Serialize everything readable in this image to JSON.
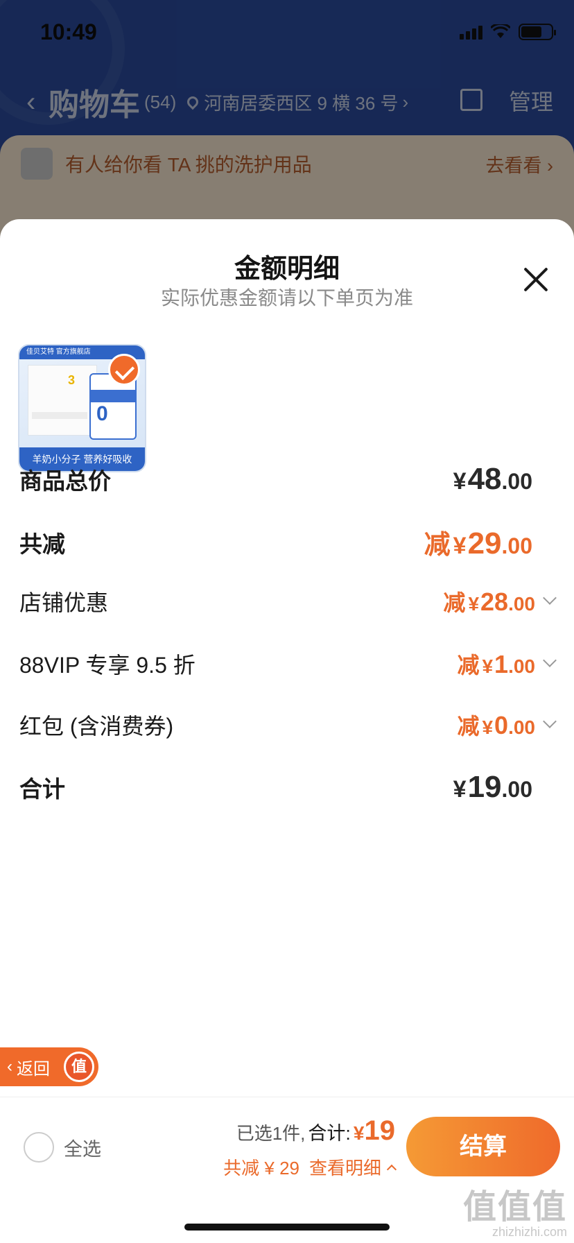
{
  "status_bar": {
    "time": "10:49"
  },
  "nav": {
    "title": "购物车",
    "count": "(54)",
    "location": "河南居委西区 9 横 36 号",
    "manage": "管理"
  },
  "banner": {
    "text": "有人给你看 TA 挑的洗护用品",
    "link": "去看看"
  },
  "sheet": {
    "title": "金额明细",
    "subtitle": "实际优惠金额请以下单页为准",
    "product": {
      "brand_bar": "佳贝艾特 官方旗舰店",
      "stage": "3",
      "panel_value": "0",
      "caption": "羊奶小分子 营养好吸收"
    },
    "rows": {
      "total": {
        "label": "商品总价",
        "cur": "¥",
        "int": "48",
        "dec": ".00"
      },
      "reduce": {
        "label": "共减",
        "prefix": "减",
        "cur": "¥",
        "int": "29",
        "dec": ".00"
      },
      "store": {
        "label": "店铺优惠",
        "prefix": "减",
        "cur": "¥",
        "int": "28",
        "dec": ".00"
      },
      "vip": {
        "label": "88VIP 专享 9.5 折",
        "prefix": "减",
        "cur": "¥",
        "int": "1",
        "dec": ".00"
      },
      "redpack": {
        "label": "红包 (含消费券)",
        "prefix": "减",
        "cur": "¥",
        "int": "0",
        "dec": ".00"
      },
      "sum": {
        "label": "合计",
        "cur": "¥",
        "int": "19",
        "dec": ".00"
      }
    }
  },
  "float_back": {
    "label": "返回",
    "badge": "值"
  },
  "bottom_bar": {
    "select_all": "全选",
    "selected": "已选1件,",
    "total_label": "合计:",
    "total_cur": "¥",
    "total_value": "19",
    "reduce_text": "共减 ¥ 29",
    "detail_link": "查看明细",
    "checkout": "结算"
  },
  "watermark": {
    "big": "值值值",
    "small": "zhizhizhi.com"
  },
  "colors": {
    "accent": "#ea6a2b",
    "header_blue": "#2a4a9c",
    "banner_bg": "#f6e6cf"
  }
}
